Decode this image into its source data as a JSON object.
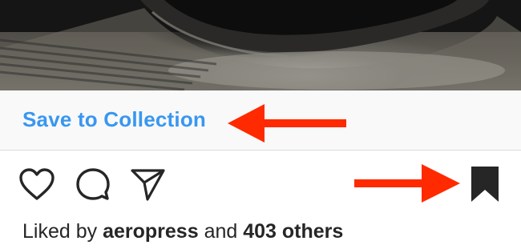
{
  "post": {
    "image_alt": "AeroPress coffee maker photo",
    "save_to_collection_label": "Save to Collection",
    "likes": {
      "prefix": "Liked by",
      "user": "aeropress",
      "connector": "and",
      "others": "403 others"
    }
  },
  "actions": {
    "icons": [
      "heart-icon",
      "comment-icon",
      "share-icon",
      "bookmark-icon"
    ],
    "bookmark_saved": true
  },
  "annotations": {
    "arrow_color": "#ff2a00"
  },
  "colors": {
    "link_blue": "#3897f0",
    "text": "#262626",
    "icon": "#262626",
    "divider": "#dbdbdb",
    "save_bar_bg": "#f9f9f9"
  }
}
